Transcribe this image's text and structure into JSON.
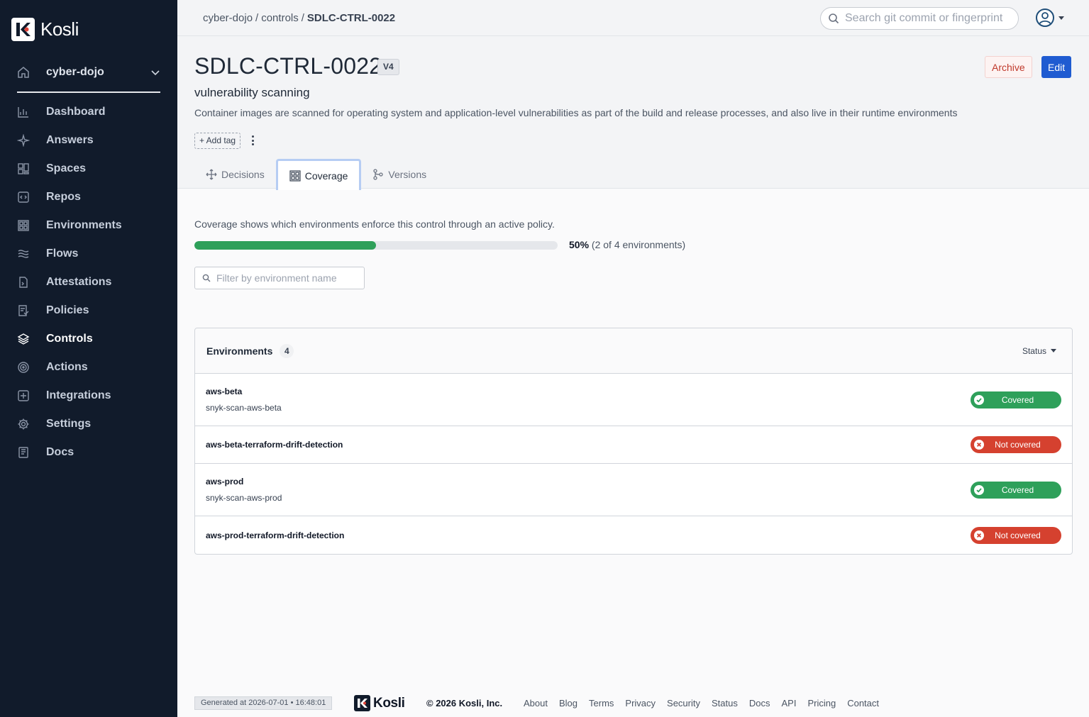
{
  "app": {
    "logo_text": "Kosli"
  },
  "sidebar": {
    "org": "cyber-dojo",
    "items": [
      {
        "label": "Dashboard",
        "icon": "chart-icon"
      },
      {
        "label": "Answers",
        "icon": "sparkle-icon"
      },
      {
        "label": "Spaces",
        "icon": "spaces-icon"
      },
      {
        "label": "Repos",
        "icon": "repo-icon"
      },
      {
        "label": "Environments",
        "icon": "grid-icon"
      },
      {
        "label": "Flows",
        "icon": "waves-icon"
      },
      {
        "label": "Attestations",
        "icon": "document-icon"
      },
      {
        "label": "Policies",
        "icon": "policy-icon"
      },
      {
        "label": "Controls",
        "icon": "layers-icon",
        "active": true
      },
      {
        "label": "Actions",
        "icon": "target-icon"
      },
      {
        "label": "Integrations",
        "icon": "plus-square-icon"
      },
      {
        "label": "Settings",
        "icon": "gear-icon"
      },
      {
        "label": "Docs",
        "icon": "book-icon"
      }
    ]
  },
  "topbar": {
    "breadcrumb": [
      "cyber-dojo",
      "controls",
      "SDLC-CTRL-0022"
    ],
    "separator": "/",
    "search_placeholder": "Search git commit or fingerprint"
  },
  "control": {
    "id": "SDLC-CTRL-0022",
    "version": "V4",
    "name": "vulnerability scanning",
    "description": "Container images are scanned for operating system and application-level vulnerabilities as part of the build and release processes, and also live in their runtime environments",
    "add_tag_label": "+ Add tag",
    "archive_label": "Archive",
    "edit_label": "Edit"
  },
  "tabs": [
    {
      "label": "Decisions",
      "icon": "move-icon"
    },
    {
      "label": "Coverage",
      "icon": "grid-icon",
      "active": true
    },
    {
      "label": "Versions",
      "icon": "branch-icon"
    }
  ],
  "coverage": {
    "intro": "Coverage shows which environments enforce this control through an active policy.",
    "percent_label": "50%",
    "percent": 0.5,
    "detail": "(2 of 4 environments)",
    "filter_placeholder": "Filter by environment name"
  },
  "environments": {
    "title": "Environments",
    "count": "4",
    "status_label": "Status",
    "rows": [
      {
        "name": "aws-beta",
        "policy": "snyk-scan-aws-beta",
        "status": "Covered",
        "covered": true
      },
      {
        "name": "aws-beta-terraform-drift-detection",
        "policy": "",
        "status": "Not covered",
        "covered": false
      },
      {
        "name": "aws-prod",
        "policy": "snyk-scan-aws-prod",
        "status": "Covered",
        "covered": true
      },
      {
        "name": "aws-prod-terraform-drift-detection",
        "policy": "",
        "status": "Not covered",
        "covered": false
      }
    ]
  },
  "footer": {
    "generated": "Generated at 2026-07-01 • 16:48:01",
    "logo_text": "Kosli",
    "copyright": "© 2026 Kosli, Inc.",
    "links": [
      "About",
      "Blog",
      "Terms",
      "Privacy",
      "Security",
      "Status",
      "Docs",
      "API",
      "Pricing",
      "Contact"
    ]
  },
  "colors": {
    "sidebar_bg": "#111b2b",
    "primary": "#1f5bd1",
    "success": "#2ea05a",
    "danger": "#d5412f"
  }
}
